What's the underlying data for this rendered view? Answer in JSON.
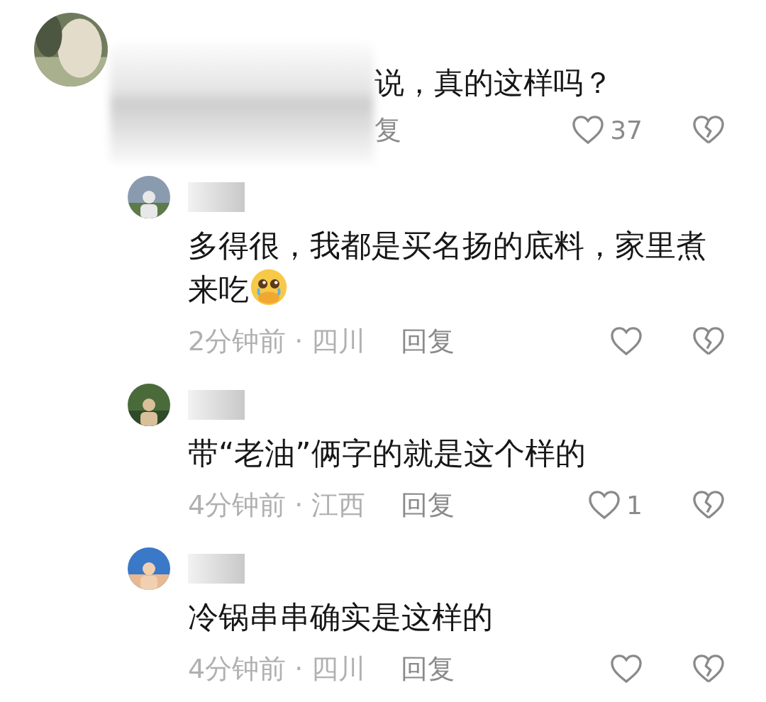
{
  "comment": {
    "text": "说，真的这样吗？",
    "reply_label": "复",
    "likes": "37"
  },
  "replies": [
    {
      "text": "多得很，我都是买名扬的底料，家里煮来吃",
      "emoji": true,
      "time": "2分钟前 · 四川",
      "reply_label": "回复"
    },
    {
      "text": "带“老油”俩字的就是这个样的",
      "emoji": false,
      "time": "4分钟前 · 江西",
      "reply_label": "回复",
      "likes": "1"
    },
    {
      "text": "冷锅串串确实是这样的",
      "emoji": false,
      "time": "4分钟前 · 四川",
      "reply_label": "回复"
    }
  ]
}
